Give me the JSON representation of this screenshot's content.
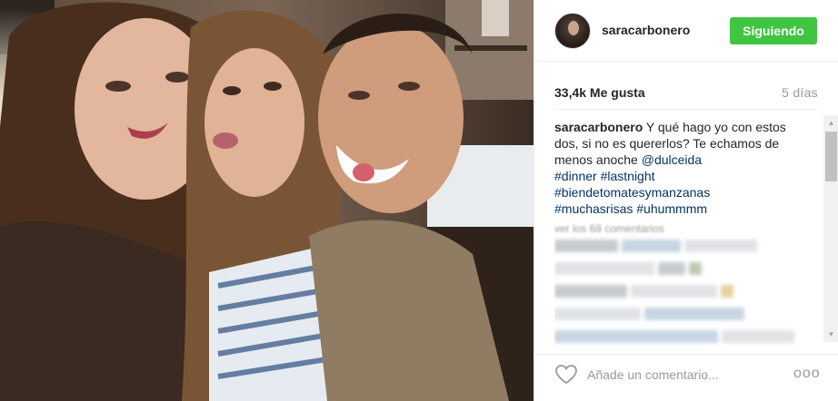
{
  "post": {
    "username": "saracarbonero",
    "follow_label": "Siguiendo",
    "likes": "33,4k Me gusta",
    "time_ago": "5 días"
  },
  "caption": {
    "username": "saracarbonero",
    "text": "Y qué hago yo con estos dos, si no es quererlos? Te echamos de menos anoche",
    "mention": "@dulceida",
    "hashtags_line1": "#dinner #lastnight",
    "hashtags_line2": "#biendetomatesymanzanas",
    "hashtags_line3": "#muchasrisas #uhummmm"
  },
  "comments": {
    "load_more": "ver los 68 comentarios"
  },
  "footer": {
    "comment_placeholder": "Añade un comentario...",
    "more_label": "ooo"
  },
  "colors": {
    "follow_green": "#3fc541",
    "hashtag_blue": "#003569",
    "muted_gray": "#999999"
  }
}
